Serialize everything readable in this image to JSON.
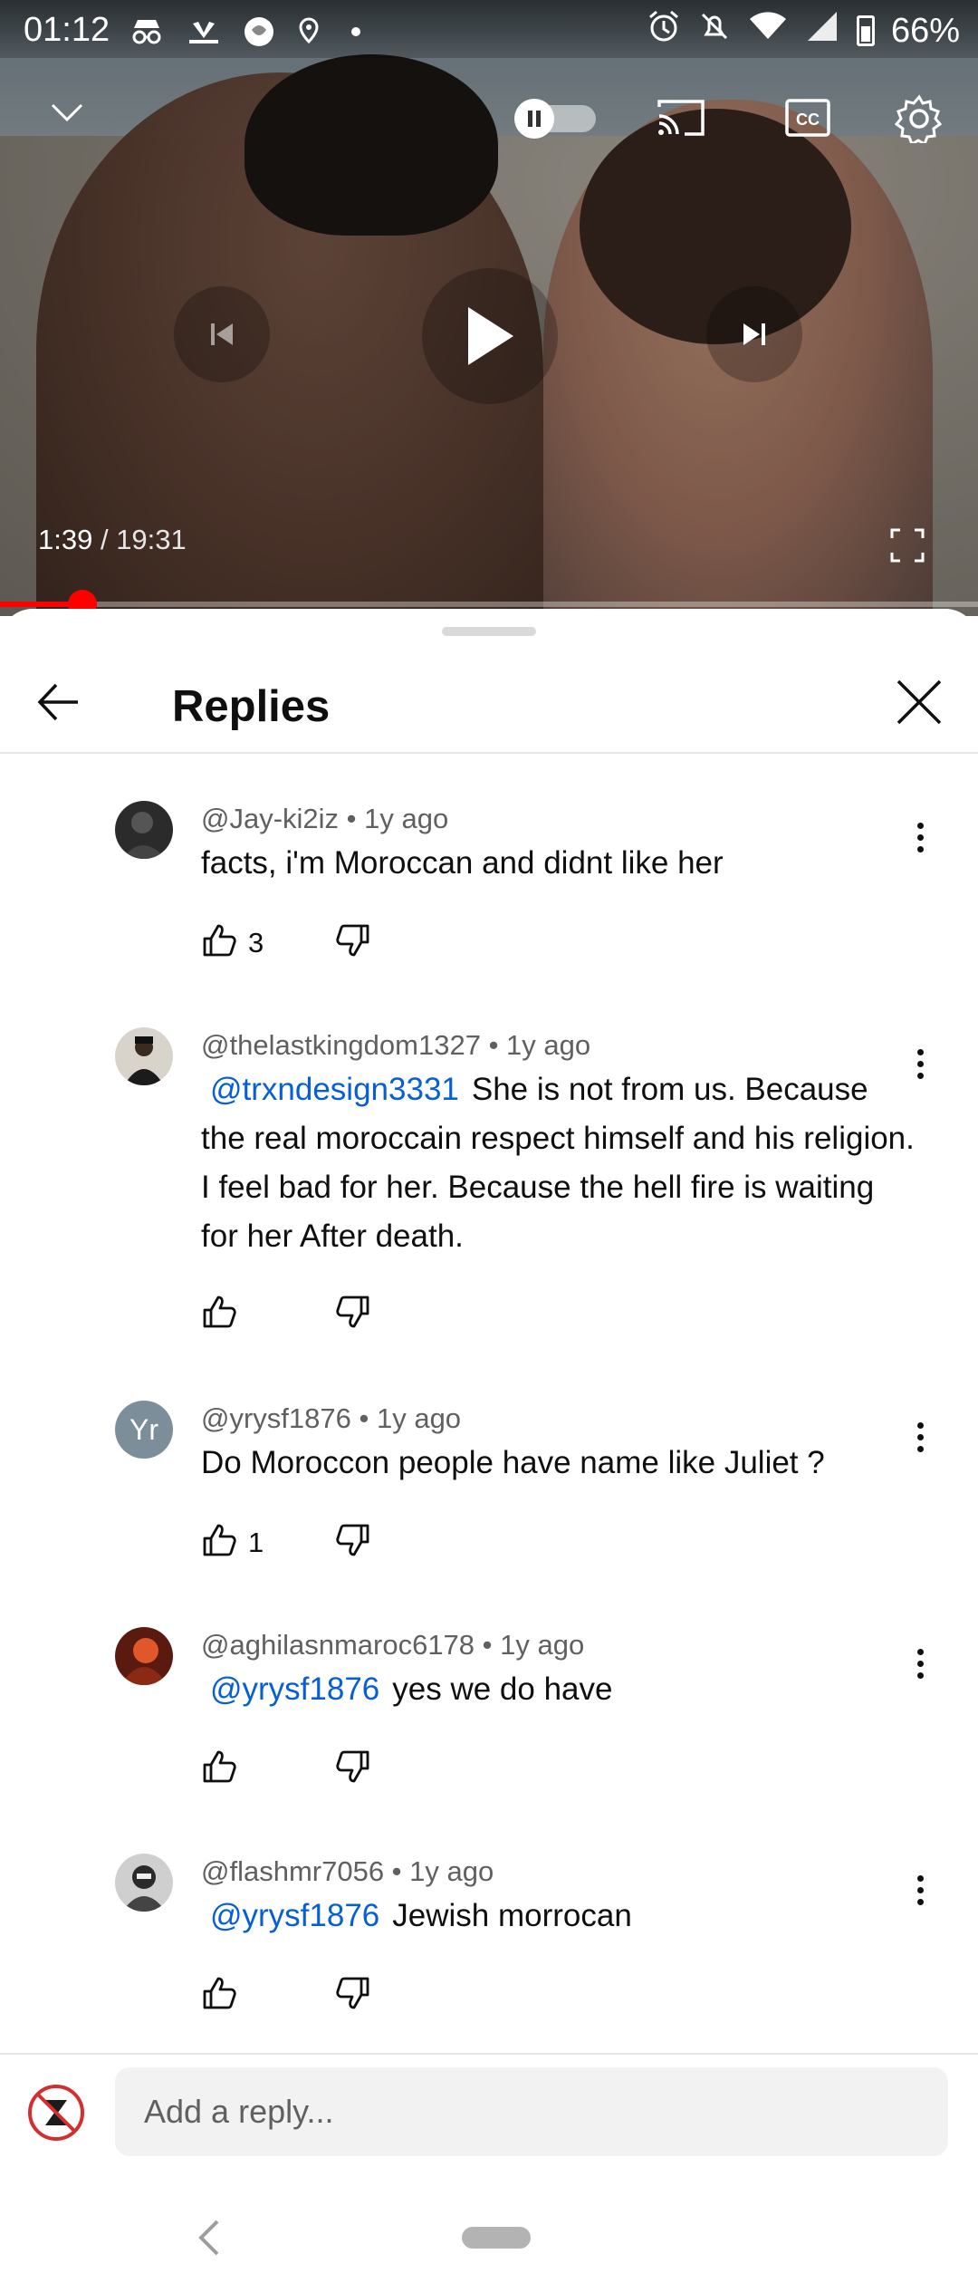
{
  "status_bar": {
    "time": "01:12",
    "left_icons": [
      "incognito-icon",
      "cnbc-icon",
      "app-icon",
      "location-icon",
      "dot-icon"
    ],
    "battery": "66%",
    "right_icons": [
      "alarm-icon",
      "mute-icon",
      "wifi-icon",
      "signal-icon",
      "battery-icon"
    ]
  },
  "player": {
    "current_time": "1:39",
    "separator": " / ",
    "duration": "19:31",
    "progress_fraction": 0.0845,
    "buffered_fraction": 0.1,
    "autoplay_state": "on",
    "icons": [
      "chevron-down-icon",
      "autoplay-toggle",
      "cast-icon",
      "captions-icon",
      "settings-gear-icon",
      "previous-icon",
      "play-icon",
      "next-icon",
      "fullscreen-icon"
    ]
  },
  "sheet": {
    "title": "Replies"
  },
  "replies": [
    {
      "handle": "@Jay-ki2iz",
      "age": "1y ago",
      "mention": "",
      "text": "facts, i'm Moroccan and didnt like her",
      "likes": "3"
    },
    {
      "handle": "@thelastkingdom1327",
      "age": "1y ago",
      "mention": "@trxndesign3331",
      "text": "She is not from us. Because the real moroccain respect himself and his religion. I feel bad for her. Because the hell fire is waiting for her After death.",
      "likes": ""
    },
    {
      "handle": "@yrysf1876",
      "age": "1y ago",
      "avatar_initials": "Yr",
      "mention": "",
      "text": "Do Moroccon people have name like Juliet ?",
      "likes": "1"
    },
    {
      "handle": "@aghilasnmaroc6178",
      "age": "1y ago",
      "mention": "@yrysf1876",
      "text": "yes we do have",
      "likes": ""
    },
    {
      "handle": "@flashmr7056",
      "age": "1y ago",
      "mention": "@yrysf1876",
      "text": "Jewish morrocan",
      "likes": ""
    }
  ],
  "composer": {
    "placeholder": "Add a reply..."
  },
  "colors": {
    "accent_red": "#ff0000",
    "mention_blue": "#065fd4",
    "meta_gray": "#606060"
  }
}
